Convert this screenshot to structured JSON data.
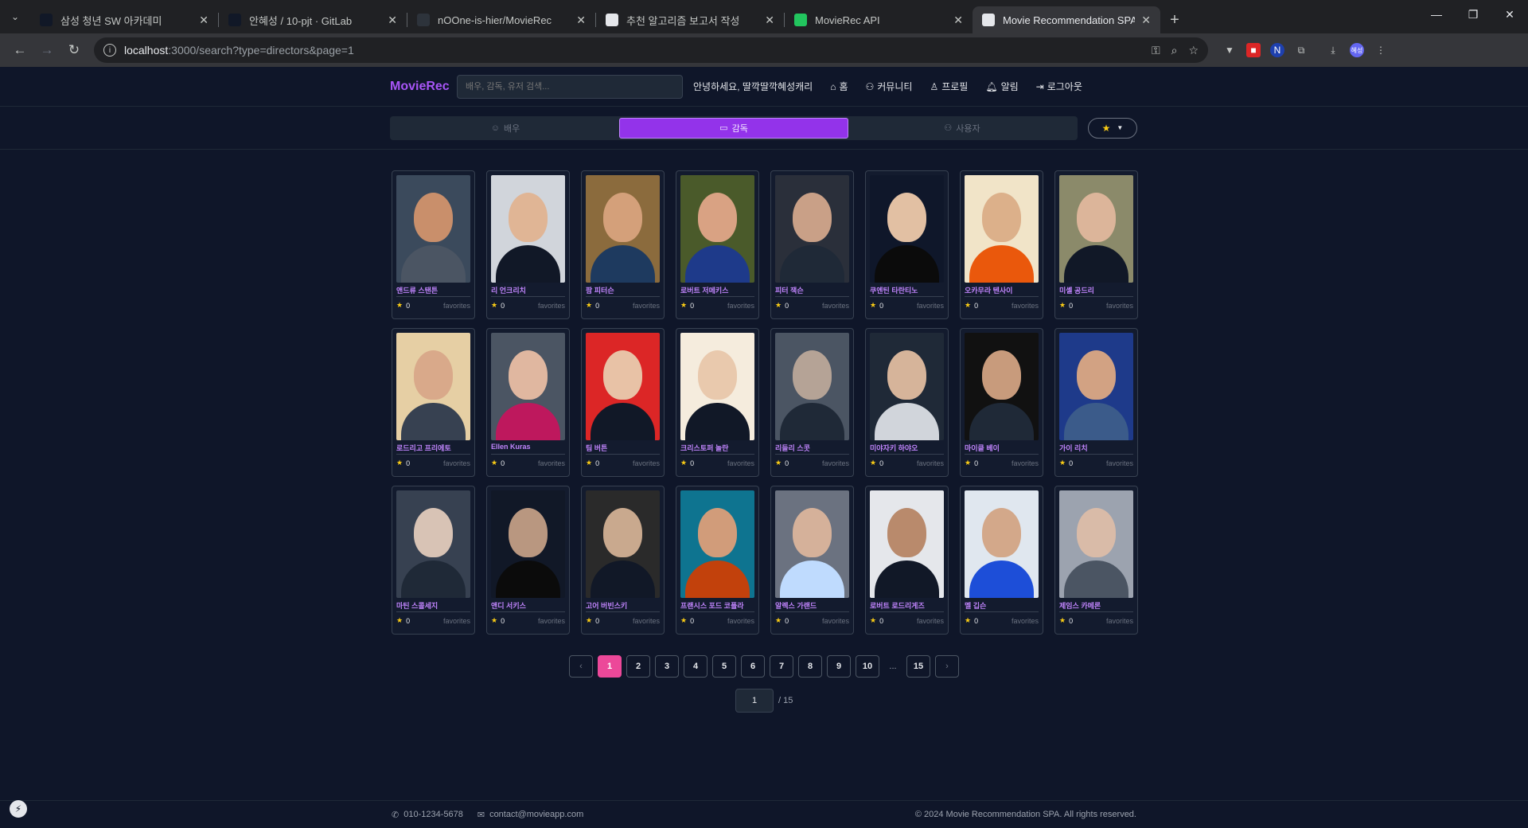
{
  "browser": {
    "tabs": [
      {
        "title": "삼성 청년 SW 아카데미",
        "icon_color": "#111827"
      },
      {
        "title": "안혜성 / 10-pjt · GitLab",
        "icon_color": "#111827"
      },
      {
        "title": "nOOne-is-hier/MovieRec",
        "icon_color": "#2d333b"
      },
      {
        "title": "추천 알고리즘 보고서 작성",
        "icon_color": "#e5e7eb"
      },
      {
        "title": "MovieRec API",
        "icon_color": "#22c55e"
      },
      {
        "title": "Movie Recommendation SPA",
        "icon_color": "#e5e7eb",
        "active": true
      }
    ],
    "url_host": "localhost",
    "url_path": ":3000/search?type=directors&page=1",
    "profile_label": "혜성"
  },
  "header": {
    "logo": "MovieRec",
    "search_placeholder": "배우, 감독, 유저 검색...",
    "greeting": "안녕하세요, 딸깍딸깍혜성캐리",
    "nav": [
      {
        "label": "홈",
        "icon": "home-icon"
      },
      {
        "label": "커뮤니티",
        "icon": "users-icon"
      },
      {
        "label": "프로필",
        "icon": "user-icon"
      },
      {
        "label": "알림",
        "icon": "bell-icon"
      },
      {
        "label": "로그아웃",
        "icon": "logout-icon"
      }
    ]
  },
  "category_tabs": [
    {
      "label": "배우",
      "icon": "actor-icon"
    },
    {
      "label": "감독",
      "icon": "camera-icon",
      "active": true
    },
    {
      "label": "사용자",
      "icon": "users-icon"
    }
  ],
  "favorites_filter": {
    "icon": "star-icon"
  },
  "directors": [
    {
      "name": "앤드류 스탠튼",
      "count": "0",
      "label": "favorites",
      "skin": "#c98f6b",
      "bg": "#3b4a5c",
      "cloth": "#4b5563"
    },
    {
      "name": "리 언크리치",
      "count": "0",
      "label": "favorites",
      "skin": "#e0b595",
      "bg": "#d1d5db",
      "cloth": "#111827"
    },
    {
      "name": "팜 피터슨",
      "count": "0",
      "label": "favorites",
      "skin": "#d4a07a",
      "bg": "#8b6b3d",
      "cloth": "#1e3a5f"
    },
    {
      "name": "로버트 저메키스",
      "count": "0",
      "label": "favorites",
      "skin": "#d9a283",
      "bg": "#4a5a2a",
      "cloth": "#1e3a8a"
    },
    {
      "name": "피터 잭슨",
      "count": "0",
      "label": "favorites",
      "skin": "#c9a087",
      "bg": "#2a2f3a",
      "cloth": "#1f2937"
    },
    {
      "name": "쿠엔틴 타란티노",
      "count": "0",
      "label": "favorites",
      "skin": "#e2c0a3",
      "bg": "#0f172a",
      "cloth": "#0b0b0b"
    },
    {
      "name": "오카무라 텐사이",
      "count": "0",
      "label": "favorites",
      "skin": "#dcb08a",
      "bg": "#f1e4c8",
      "cloth": "#ea580c"
    },
    {
      "name": "미셸 공드리",
      "count": "0",
      "label": "favorites",
      "skin": "#dcb59a",
      "bg": "#8b8a6a",
      "cloth": "#111827"
    },
    {
      "name": "로드리고 프리에토",
      "count": "0",
      "label": "favorites",
      "skin": "#d9a98a",
      "bg": "#e6cfa4",
      "cloth": "#374151"
    },
    {
      "name": "Ellen Kuras",
      "count": "0",
      "label": "favorites",
      "skin": "#e0b7a0",
      "bg": "#4b5563",
      "cloth": "#be185d"
    },
    {
      "name": "팀 버튼",
      "count": "0",
      "label": "favorites",
      "skin": "#e8c2a6",
      "bg": "#dc2626",
      "cloth": "#111827"
    },
    {
      "name": "크리스토퍼 놀란",
      "count": "0",
      "label": "favorites",
      "skin": "#e9c9ad",
      "bg": "#f5ecdd",
      "cloth": "#111827"
    },
    {
      "name": "리들리 스콧",
      "count": "0",
      "label": "favorites",
      "skin": "#b5a396",
      "bg": "#4b5563",
      "cloth": "#1f2937"
    },
    {
      "name": "미야자키 하야오",
      "count": "0",
      "label": "favorites",
      "skin": "#d6b49a",
      "bg": "#1f2937",
      "cloth": "#d1d5db"
    },
    {
      "name": "마이클 베이",
      "count": "0",
      "label": "favorites",
      "skin": "#c89b7c",
      "bg": "#111111",
      "cloth": "#1f2937"
    },
    {
      "name": "가이 리치",
      "count": "0",
      "label": "favorites",
      "skin": "#d2a283",
      "bg": "#1e3a8a",
      "cloth": "#3b5b8a"
    },
    {
      "name": "마틴 스콜세지",
      "count": "0",
      "label": "favorites",
      "skin": "#d8c3b5",
      "bg": "#374151",
      "cloth": "#1f2937"
    },
    {
      "name": "앤디 서키스",
      "count": "0",
      "label": "favorites",
      "skin": "#b99780",
      "bg": "#111827",
      "cloth": "#0b0b0b"
    },
    {
      "name": "고어 버빈스키",
      "count": "0",
      "label": "favorites",
      "skin": "#c9a98e",
      "bg": "#2a2a2a",
      "cloth": "#111827"
    },
    {
      "name": "프랜시스 포드 코폴라",
      "count": "0",
      "label": "favorites",
      "skin": "#d19c7a",
      "bg": "#0e7490",
      "cloth": "#c2410c"
    },
    {
      "name": "알렉스 가랜드",
      "count": "0",
      "label": "favorites",
      "skin": "#d5b19a",
      "bg": "#6b7280",
      "cloth": "#bfdbfe"
    },
    {
      "name": "로버트 로드리게즈",
      "count": "0",
      "label": "favorites",
      "skin": "#b98a6c",
      "bg": "#e5e7eb",
      "cloth": "#111827"
    },
    {
      "name": "멜 깁슨",
      "count": "0",
      "label": "favorites",
      "skin": "#d3a88a",
      "bg": "#e0e7ef",
      "cloth": "#1d4ed8"
    },
    {
      "name": "제임스 카메론",
      "count": "0",
      "label": "favorites",
      "skin": "#d9bba8",
      "bg": "#9ca3af",
      "cloth": "#4b5563"
    }
  ],
  "pagination": {
    "prev_icon": "chevron-left-icon",
    "pages": [
      "1",
      "2",
      "3",
      "4",
      "5",
      "6",
      "7",
      "8",
      "9",
      "10"
    ],
    "ellipsis": "...",
    "last": "15",
    "next_icon": "chevron-right-icon",
    "current": "1",
    "jump_value": "1",
    "total_label": "/ 15"
  },
  "footer": {
    "phone": "010-1234-5678",
    "email": "contact@movieapp.com",
    "copyright": "© 2024 Movie Recommendation SPA. All rights reserved."
  },
  "colors": {
    "accent": "#a855f7",
    "active_tab": "#9333ea",
    "active_page": "#ec4899",
    "star": "#facc15",
    "background": "#0f1629"
  }
}
